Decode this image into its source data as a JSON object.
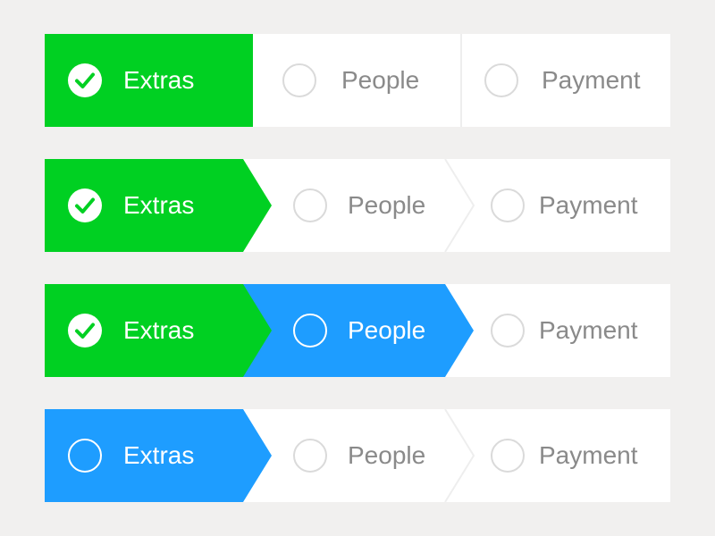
{
  "colors": {
    "page_background": "#f1f0ef",
    "complete": "#00d022",
    "current": "#1e9dff",
    "pending_background": "#ffffff",
    "pending_text": "#8a8a8a",
    "pending_circle": "#dadada",
    "divider": "#eeeeee"
  },
  "steppers": [
    {
      "style": "flat",
      "steps": [
        {
          "label": "Extras",
          "state": "complete",
          "icon": "checkmark-icon"
        },
        {
          "label": "People",
          "state": "pending",
          "icon": "empty-circle-icon"
        },
        {
          "label": "Payment",
          "state": "pending",
          "icon": "empty-circle-icon"
        }
      ]
    },
    {
      "style": "arrow",
      "steps": [
        {
          "label": "Extras",
          "state": "complete",
          "icon": "checkmark-icon"
        },
        {
          "label": "People",
          "state": "pending",
          "icon": "empty-circle-icon"
        },
        {
          "label": "Payment",
          "state": "pending",
          "icon": "empty-circle-icon"
        }
      ]
    },
    {
      "style": "arrow",
      "steps": [
        {
          "label": "Extras",
          "state": "complete",
          "icon": "checkmark-icon"
        },
        {
          "label": "People",
          "state": "current",
          "icon": "empty-circle-icon"
        },
        {
          "label": "Payment",
          "state": "pending",
          "icon": "empty-circle-icon"
        }
      ]
    },
    {
      "style": "arrow",
      "steps": [
        {
          "label": "Extras",
          "state": "current",
          "icon": "empty-circle-icon"
        },
        {
          "label": "People",
          "state": "pending",
          "icon": "empty-circle-icon"
        },
        {
          "label": "Payment",
          "state": "pending",
          "icon": "empty-circle-icon"
        }
      ]
    }
  ]
}
